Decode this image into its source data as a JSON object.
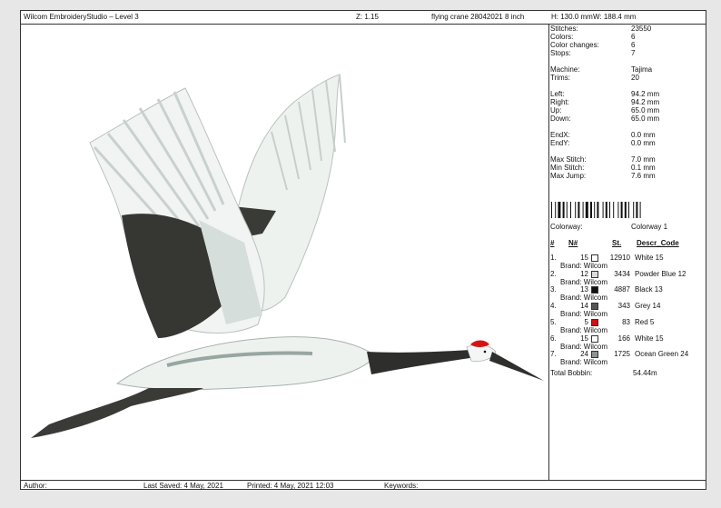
{
  "header": {
    "app_title": "Wilcom EmbroideryStudio – Level 3",
    "zoom": "Z: 1.15",
    "design_name": "flying crane 28042021 8 inch",
    "height": "H: 130.0 mm",
    "width": "W: 188.4 mm"
  },
  "stats": [
    {
      "label": "Stitches:",
      "value": "23550"
    },
    {
      "label": "Colors:",
      "value": "6"
    },
    {
      "label": "Color changes:",
      "value": "6"
    },
    {
      "label": "Stops:",
      "value": "7"
    },
    {
      "label": "Machine:",
      "value": "Tajima"
    },
    {
      "label": "Trims:",
      "value": "20"
    },
    {
      "label": "Left:",
      "value": "94.2 mm"
    },
    {
      "label": "Right:",
      "value": "94.2 mm"
    },
    {
      "label": "Up:",
      "value": "65.0 mm"
    },
    {
      "label": "Down:",
      "value": "65.0 mm"
    },
    {
      "label": "EndX:",
      "value": "0.0 mm"
    },
    {
      "label": "EndY:",
      "value": "0.0 mm"
    },
    {
      "label": "Max Stitch:",
      "value": "7.0 mm"
    },
    {
      "label": "Min Stitch:",
      "value": "0.1 mm"
    },
    {
      "label": "Max Jump:",
      "value": "7.6 mm"
    }
  ],
  "colorway": {
    "label": "Colorway:",
    "value": "Colorway 1"
  },
  "color_headers": {
    "num": "#",
    "n": "N#",
    "st": "St.",
    "descr": "Descr_Code"
  },
  "colors": [
    {
      "idx": "1.",
      "n": "15",
      "swatch": "#ffffff",
      "st": "12910",
      "descr": "White 15",
      "brand": "Brand: Wilcom"
    },
    {
      "idx": "2.",
      "n": "12",
      "swatch": "#dcdcdc",
      "st": "3434",
      "descr": "Powder Blue 12",
      "brand": "Brand: Wilcom"
    },
    {
      "idx": "3.",
      "n": "13",
      "swatch": "#111111",
      "st": "4887",
      "descr": "Black 13",
      "brand": "Brand: Wilcom"
    },
    {
      "idx": "4.",
      "n": "14",
      "swatch": "#555555",
      "st": "343",
      "descr": "Grey 14",
      "brand": "Brand: Wilcom"
    },
    {
      "idx": "5.",
      "n": "5",
      "swatch": "#cc1111",
      "st": "83",
      "descr": "Red 5",
      "brand": "Brand: Wilcom"
    },
    {
      "idx": "6.",
      "n": "15",
      "swatch": "#ffffff",
      "st": "166",
      "descr": "White 15",
      "brand": "Brand: Wilcom"
    },
    {
      "idx": "7.",
      "n": "24",
      "swatch": "#8a9492",
      "st": "1725",
      "descr": "Ocean Green 24",
      "brand": "Brand: Wilcom"
    }
  ],
  "total_bobbin": {
    "label": "Total Bobbin:",
    "value": "54.44m"
  },
  "footer": {
    "author": "Author:",
    "last_saved": "Last Saved:  4 May, 2021",
    "printed": "Printed:   4 May, 2021 12:03",
    "keywords": "Keywords:"
  }
}
